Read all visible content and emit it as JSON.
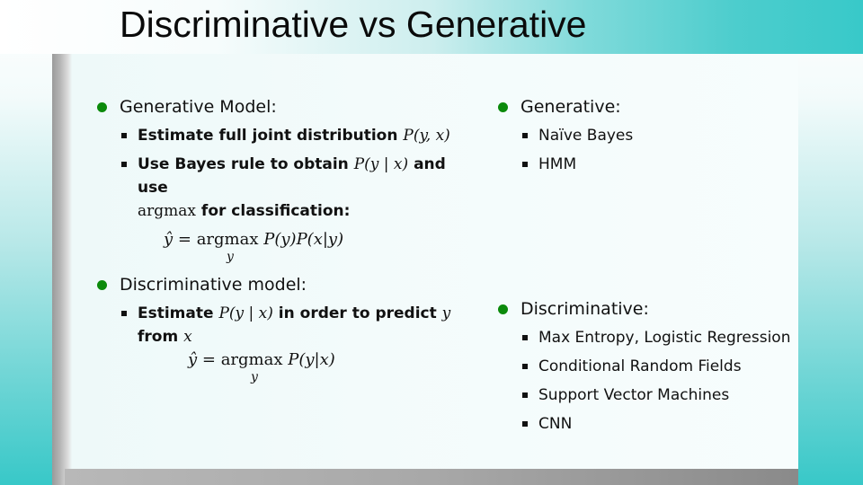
{
  "slide": {
    "title": "Discriminative vs Generative",
    "colors": {
      "accent_teal": "#38c9c9",
      "bullet_green": "#0b8a0b",
      "text": "#111111"
    }
  },
  "left_column": {
    "generative": {
      "heading": "Generative Model:",
      "items": [
        {
          "text": "Estimate full joint distribution ",
          "math": "P(y, x)"
        },
        {
          "text": "Use Bayes rule to obtain ",
          "math": "P(y | x)",
          "text_after": " and use",
          "line2_math": "argmax",
          "line2_text": " for classification:"
        }
      ],
      "formula": {
        "lhs": "ŷ = ",
        "op": "argmax",
        "rhs": " P(y)P(x|y)",
        "subscript": "y"
      }
    },
    "discriminative": {
      "heading": "Discriminative model:",
      "items": [
        {
          "text": "Estimate ",
          "math": "P(y | x)",
          "text_after": " in order to predict ",
          "math2": "y",
          "line2_text": "from ",
          "line2_math": "x"
        }
      ],
      "formula": {
        "lhs": "ŷ = ",
        "op": "argmax",
        "rhs": " P(y|x)",
        "subscript": "y"
      }
    }
  },
  "right_column": {
    "generative": {
      "heading": "Generative:",
      "items": [
        "Naïve Bayes",
        "HMM"
      ]
    },
    "discriminative": {
      "heading": "Discriminative:",
      "items": [
        "Max Entropy, Logistic Regression",
        "Conditional Random Fields",
        "Support Vector Machines",
        "CNN"
      ]
    }
  },
  "icons": {
    "level1_bullet": "green-dot-icon",
    "level2_bullet": "black-square-icon"
  }
}
